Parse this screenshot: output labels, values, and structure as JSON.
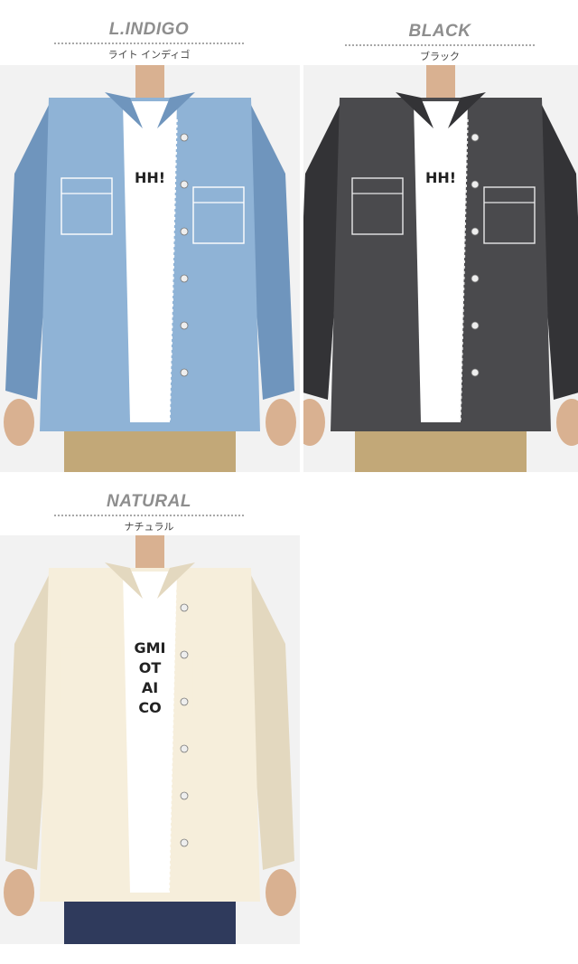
{
  "variants": [
    {
      "name": "L.INDIGO",
      "kana": "ライト インディゴ",
      "shirt_color": "#8fb3d6",
      "shirt_shade": "#6f95bd",
      "stitch_color": "#ffffff",
      "pants_color": "#c2a878",
      "tee_print": "HH!"
    },
    {
      "name": "BLACK",
      "kana": "ブラック",
      "shirt_color": "#4a4a4d",
      "shirt_shade": "#333336",
      "stitch_color": "#e8e8e8",
      "pants_color": "#c2a878",
      "tee_print": "HH!"
    },
    {
      "name": "NATURAL",
      "kana": "ナチュラル",
      "shirt_color": "#f6eedb",
      "shirt_shade": "#e3d8bf",
      "stitch_color": "#f6eedb",
      "pants_color": "#2f3a5c",
      "tee_print": "GMI\nOT\nAI\nCO"
    }
  ]
}
